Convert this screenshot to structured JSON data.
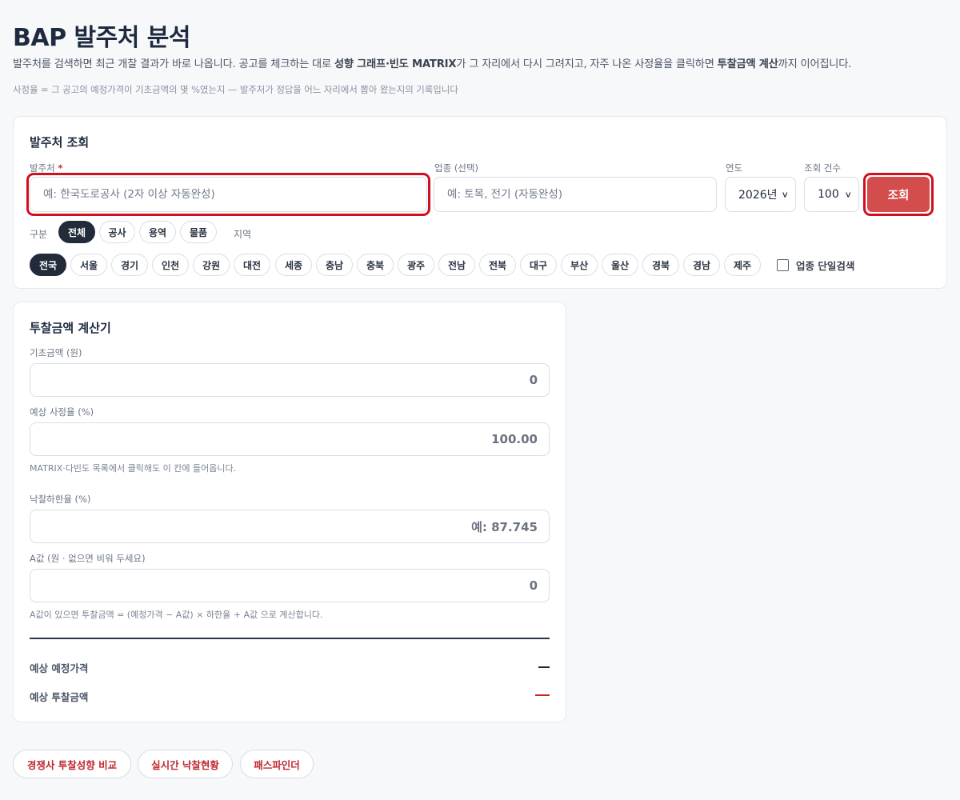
{
  "header": {
    "title": "BAP 발주처 분석",
    "desc_part1": "발주처를 검색하면 최근 개찰 결과가 바로 나옵니다. 공고를 체크하는 대로 ",
    "desc_bold1": "성향 그래프·빈도 MATRIX",
    "desc_part2": "가 그 자리에서 다시 그려지고, 자주 나온 사정율을 클릭하면 ",
    "desc_bold2": "투찰금액 계산",
    "desc_part3": "까지 이어집니다.",
    "note": "사정율 = 그 공고의 예정가격이 기초금액의 몇 %였는지 — 발주처가 정답을 어느 자리에서 뽑아 왔는지의 기록입니다"
  },
  "search": {
    "title": "발주처 조회",
    "agency_label": "발주처",
    "agency_required": "*",
    "agency_placeholder": "예: 한국도로공사 (2자 이상 자동완성)",
    "industry_label": "업종 (선택)",
    "industry_placeholder": "예: 토목, 전기 (자동완성)",
    "year_label": "연도",
    "year_value": "2026년",
    "count_label": "조회 건수",
    "count_value": "100",
    "search_button": "조회",
    "category_label": "구분",
    "categories": [
      "전체",
      "공사",
      "용역",
      "물품"
    ],
    "active_category": "전체",
    "region_label": "지역",
    "regions": [
      "전국",
      "서울",
      "경기",
      "인천",
      "강원",
      "대전",
      "세종",
      "충남",
      "충북",
      "광주",
      "전남",
      "전북",
      "대구",
      "부산",
      "울산",
      "경북",
      "경남",
      "제주"
    ],
    "active_region": "전국",
    "single_industry_label": "업종 단일검색",
    "single_industry_checked": false
  },
  "calculator": {
    "title": "투찰금액 계산기",
    "base_label": "기초금액 (원)",
    "base_value": "0",
    "rate_label": "예상 사정율 (%)",
    "rate_value": "100.00",
    "rate_hint": "MATRIX·다빈도 목록에서 클릭해도 이 칸에 들어옵니다.",
    "lower_label": "낙찰하한율 (%)",
    "lower_placeholder": "예: 87.745",
    "a_label": "A값 (원 · 없으면 비워 두세요)",
    "a_value": "0",
    "a_hint": "A값이 있으면 투찰금액 = (예정가격 − A값) × 하한율 + A값 으로 계산합니다.",
    "est_price_label": "예상 예정가격",
    "est_bid_label": "예상 투찰금액",
    "dash_color_dark": "#1f2a3c",
    "dash_color_red": "#c0282f"
  },
  "footer_links": [
    "경쟁사 투찰성향 비교",
    "실시간 낙찰현황",
    "패스파인더"
  ],
  "colors": {
    "accent_red": "#d44d4d",
    "highlight_red": "#d0101e",
    "dark_navy": "#222b3a"
  }
}
